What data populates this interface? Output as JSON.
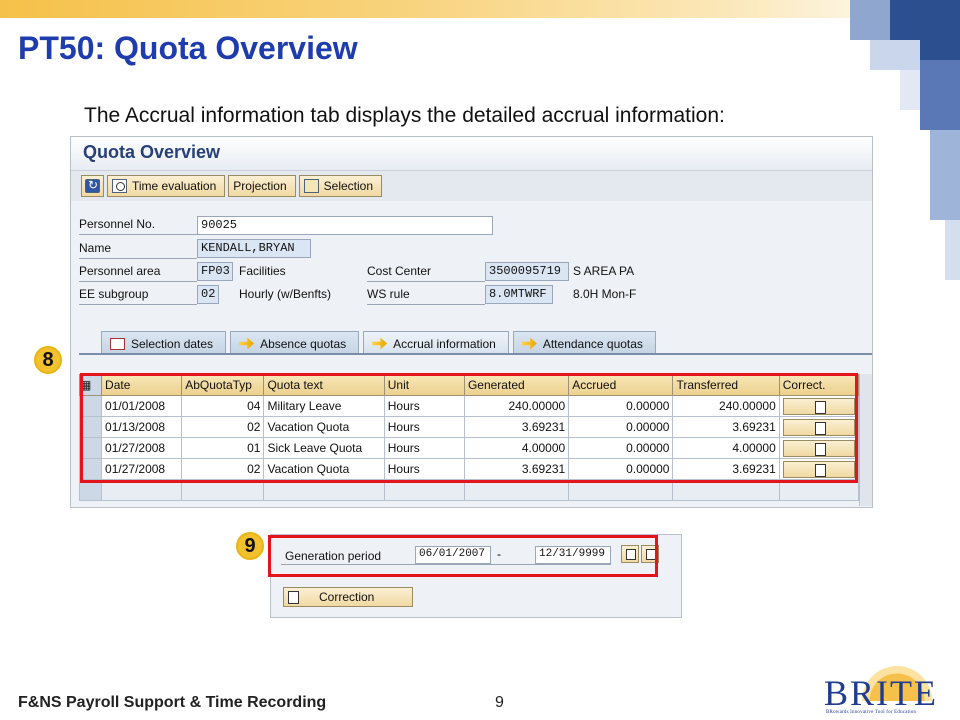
{
  "slide": {
    "title": "PT50: Quota Overview",
    "subtitle": "The Accrual information tab displays the detailed accrual information:",
    "footer_text": "F&NS Payroll Support & Time Recording",
    "page_number": "9"
  },
  "logo": {
    "wordmark": "BRITE",
    "tagline": "BRowards Innovative Tool for Education"
  },
  "sap": {
    "screen_title": "Quota Overview",
    "toolbar": {
      "time_evaluation": "Time evaluation",
      "projection": "Projection",
      "selection": "Selection"
    },
    "header": {
      "personnel_no_label": "Personnel No.",
      "personnel_no_value": "90025",
      "name_label": "Name",
      "name_value": "KENDALL,BRYAN",
      "personnel_area_label": "Personnel area",
      "personnel_area_value": "FP03",
      "personnel_area_text": "Facilities",
      "cost_center_label": "Cost Center",
      "cost_center_value": "3500095719",
      "cost_center_text": "S AREA PA",
      "ee_subgroup_label": "EE subgroup",
      "ee_subgroup_value": "02",
      "ee_subgroup_text": "Hourly  (w/Benfts)",
      "ws_rule_label": "WS rule",
      "ws_rule_value": "8.0MTWRF",
      "ws_rule_text": "8.0H Mon-F"
    },
    "tabs": [
      {
        "label": "Selection dates"
      },
      {
        "label": "Absence quotas"
      },
      {
        "label": "Accrual information"
      },
      {
        "label": "Attendance quotas"
      }
    ],
    "table": {
      "columns": [
        "Date",
        "AbQuotaTyp",
        "Quota text",
        "Unit",
        "Generated",
        "Accrued",
        "Transferred",
        "Correct."
      ],
      "rows": [
        [
          "01/01/2008",
          "04",
          "Military Leave",
          "Hours",
          "240.00000",
          "0.00000",
          "240.00000"
        ],
        [
          "01/13/2008",
          "02",
          "Vacation Quota",
          "Hours",
          "3.69231",
          "0.00000",
          "3.69231"
        ],
        [
          "01/27/2008",
          "01",
          "Sick Leave Quota",
          "Hours",
          "4.00000",
          "0.00000",
          "4.00000"
        ],
        [
          "01/27/2008",
          "02",
          "Vacation Quota",
          "Hours",
          "3.69231",
          "0.00000",
          "3.69231"
        ]
      ]
    }
  },
  "badges": {
    "eight": "8",
    "nine": "9"
  },
  "generation": {
    "label": "Generation period",
    "from": "06/01/2007",
    "separator": "-",
    "to": "12/31/9999",
    "correction_button": "Correction"
  }
}
